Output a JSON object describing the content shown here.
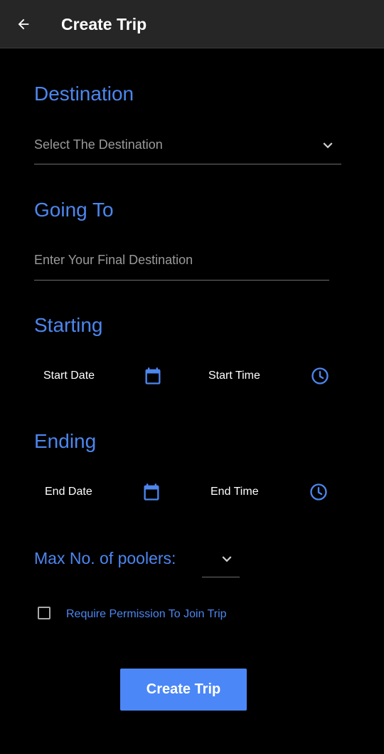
{
  "app_bar": {
    "title": "Create Trip",
    "back_icon": "arrow-left-icon",
    "background": "#262626"
  },
  "destination": {
    "heading": "Destination",
    "select_text": "Select The Destination",
    "icon": "chevron-down-icon"
  },
  "going_to": {
    "heading": "Going To",
    "placeholder": "Enter Your Final Destination",
    "value": ""
  },
  "starting": {
    "heading": "Starting",
    "date_label": "Start Date",
    "date_icon": "calendar-icon",
    "time_label": "Start Time",
    "time_icon": "clock-icon"
  },
  "ending": {
    "heading": "Ending",
    "date_label": "End Date",
    "date_icon": "calendar-icon",
    "time_label": "End Time",
    "time_icon": "clock-icon"
  },
  "poolers": {
    "heading": "Max No. of poolers:",
    "selected_value": "",
    "icon": "chevron-down-icon"
  },
  "permission": {
    "label": "Require Permission To Join Trip",
    "checked": false
  },
  "submit": {
    "label": "Create Trip"
  },
  "colors": {
    "accent": "#4d86ee",
    "button": "#4b87f7",
    "background": "#000000",
    "hint_text": "#9a9a9a"
  }
}
